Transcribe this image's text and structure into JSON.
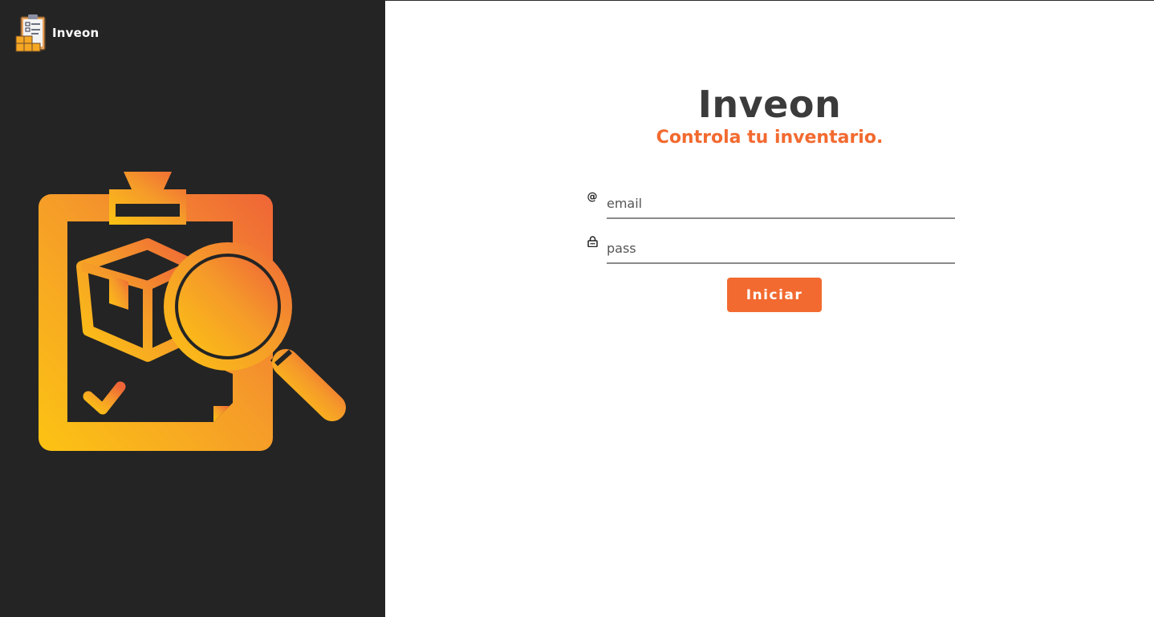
{
  "brand": {
    "name": "Inveon",
    "logo_icon": "clipboard-boxes-icon"
  },
  "hero": {
    "icon": "clipboard-magnifier-icon"
  },
  "login": {
    "title": "Inveon",
    "subtitle": "Controla tu inventario.",
    "email": {
      "icon": "at-icon",
      "placeholder": "email",
      "value": ""
    },
    "password": {
      "icon": "lock-icon",
      "placeholder": "pass",
      "value": ""
    },
    "submit_label": "Iniciar"
  },
  "colors": {
    "accent": "#f26a30",
    "sidebar_bg": "#242424",
    "gradient_start": "#fcc313",
    "gradient_end": "#ef6537"
  }
}
